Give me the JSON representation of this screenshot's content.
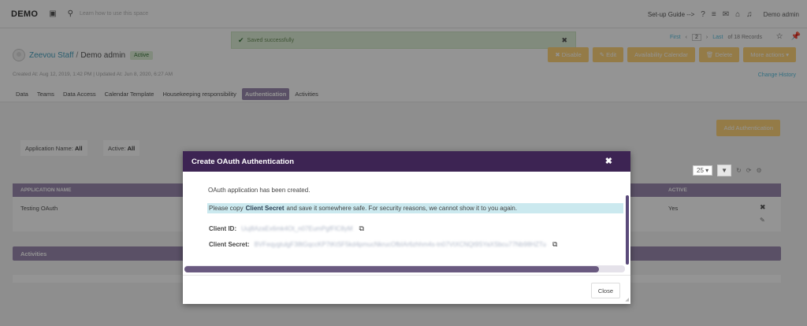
{
  "topbar": {
    "brand": "DEMO",
    "search_hint": "Learn how to use this space",
    "setup_guide": "Set-up Guide -->",
    "user": "Demo admin"
  },
  "toast": {
    "message": "Saved successfully"
  },
  "pager": {
    "first": "First",
    "page": "2",
    "last": "Last",
    "count": "of 18 Records"
  },
  "record": {
    "parent": "Zeevou Staff",
    "separator": "/",
    "name": "Demo admin",
    "status": "Active",
    "created": "Created At: Aug 12, 2019, 1:42 PM",
    "updated": "Updated At: Jun 8, 2020, 6:27 AM"
  },
  "actions": {
    "disable": "Disable",
    "edit": "Edit",
    "availability": "Availability Calendar",
    "delete": "Delete",
    "more": "More actions",
    "change_history": "Change History"
  },
  "tabs": [
    {
      "label": "Data"
    },
    {
      "label": "Teams"
    },
    {
      "label": "Data Access"
    },
    {
      "label": "Calendar Template"
    },
    {
      "label": "Housekeeping responsibility"
    },
    {
      "label": "Authentication"
    },
    {
      "label": "Activities"
    }
  ],
  "auth_panel": {
    "add_button": "Add Authentication",
    "filter_app_label": "Application Name:",
    "filter_app_value": "All",
    "filter_active_label": "Active:",
    "filter_active_value": "All",
    "page_size": "25",
    "col_app": "APPLICATION NAME",
    "col_active": "ACTIVE",
    "row_app": "Testing OAuth",
    "row_active": "Yes"
  },
  "activities": {
    "title": "Activities"
  },
  "modal": {
    "title": "Create OAuth Authentication",
    "msg_created": "OAuth application has been created.",
    "msg_copy_before": "Please copy",
    "msg_copy_strong": "Client Secret",
    "msg_copy_after": "and save it somewhere safe. For security reasons, we cannot show it to you again.",
    "client_id_label": "Client ID:",
    "client_id_value": "Uuj8AzaEx6mk4Ot_n07EumPgfFlC8yM",
    "client_secret_label": "Client Secret:",
    "client_secret_value": "BVFeqygtulgF38tGqccKP7tKtSF5kd4pmucNkrucOfbIAr6zhhm4s-tn07VtXCNQt9SYaXSbcu77Nb98HZTu",
    "close_button": "Close"
  }
}
